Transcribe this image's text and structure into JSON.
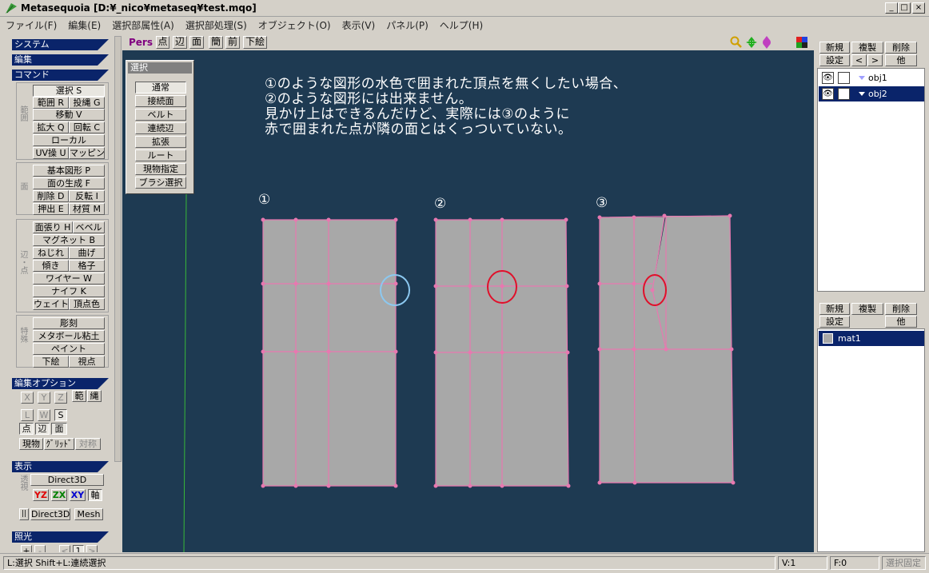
{
  "window": {
    "title": "Metasequoia [D:¥_nico¥metaseq¥test.mqo]",
    "minimize": "_",
    "maximize": "□",
    "close": "×"
  },
  "menu": [
    "ファイル(F)",
    "編集(E)",
    "選択部属性(A)",
    "選択部処理(S)",
    "オブジェクト(O)",
    "表示(V)",
    "パネル(P)",
    "ヘルプ(H)"
  ],
  "left": {
    "sections": {
      "system": "システム",
      "edit": "編集",
      "command": "コマンド",
      "edit_option": "編集オプション",
      "display": "表示",
      "light": "照光"
    },
    "groups": {
      "range": "範囲",
      "face": "面",
      "edge_vertex": "辺・点",
      "special": "特殊"
    },
    "range_buttons": [
      "選択 S",
      "範囲 R",
      "投縄 G",
      "移動 V",
      "拡大 Q",
      "回転 C",
      "ローカル",
      "UV操 U",
      "マッピング"
    ],
    "face_buttons": [
      "基本図形 P",
      "面の生成 F",
      "削除 D",
      "反転 I",
      "押出 E",
      "材質 M"
    ],
    "edge_buttons": [
      "面張り H",
      "ベベル",
      "マグネット B",
      "ねじれ",
      "曲げ",
      "傾き",
      "格子",
      "ワイヤー W",
      "ナイフ K",
      "ウェイト",
      "頂点色"
    ],
    "special_buttons": [
      "彫刻",
      "メタボール粘土",
      "ペイント",
      "下絵",
      "視点"
    ],
    "options": {
      "x": "X",
      "y": "Y",
      "z": "Z",
      "range": "範",
      "lasso": "縄",
      "l": "L",
      "w": "W",
      "s": "S",
      "vertex": "点",
      "edge": "辺",
      "face": "面",
      "current": "現物",
      "grid": "ｸﾞﾘｯﾄﾞ",
      "symmetric": "対称"
    },
    "display": {
      "renderer": "Direct3D",
      "yz": "YZ",
      "zx": "ZX",
      "xy": "XY",
      "axis": "軸",
      "direct3d2": "Direct3D",
      "mesh": "Mesh"
    },
    "light": {
      "plus": "+",
      "minus": "-",
      "prev": "<",
      "num": "1",
      "next": ">"
    }
  },
  "viewport": {
    "toolbar": {
      "pers": "Pers",
      "vertex": "点",
      "edge": "辺",
      "face": "面",
      "simple": "簡",
      "front": "前",
      "underlay": "下絵"
    },
    "palette": {
      "title": "選択",
      "buttons": [
        "通常",
        "接続面",
        "ベルト",
        "連続辺",
        "拡張",
        "ルート",
        "現物指定",
        "ブラシ選択"
      ]
    },
    "note_lines": [
      "①のような図形の水色で囲まれた頂点を無くしたい場合、",
      "②のような図形には出来ません。",
      "見かけ上はできるんだけど、実際には③のように",
      "赤で囲まれた点が隣の面とはくっついていない。"
    ],
    "figure_labels": [
      "①",
      "②",
      "③"
    ],
    "colors": {
      "background": "#1e3a52",
      "face": "#a8a8a8",
      "edge": "#e878b0",
      "blue_circle": "#8cc8f0",
      "red_circle": "#e0102a"
    }
  },
  "objects": {
    "buttons": {
      "new": "新規",
      "copy": "複製",
      "delete": "削除",
      "settings": "設定",
      "up": "<",
      "down": ">",
      "other": "他"
    },
    "items": [
      {
        "name": "obj1",
        "selected": false
      },
      {
        "name": "obj2",
        "selected": true
      }
    ]
  },
  "materials": {
    "buttons": {
      "new": "新規",
      "copy": "複製",
      "delete": "削除",
      "settings": "設定",
      "other": "他"
    },
    "items": [
      {
        "name": "mat1",
        "selected": true
      }
    ]
  },
  "status": {
    "hint": "L:選択  Shift+L:連続選択",
    "vertices": "V:1",
    "faces": "F:0",
    "lock": "選択固定"
  }
}
